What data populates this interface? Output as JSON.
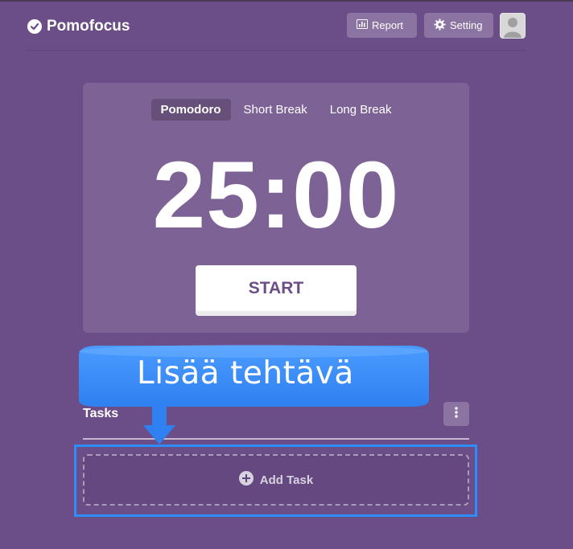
{
  "app": {
    "brand": "Pomofocus"
  },
  "header": {
    "report_label": "Report",
    "setting_label": "Setting"
  },
  "timer": {
    "modes": [
      "Pomodoro",
      "Short Break",
      "Long Break"
    ],
    "active_mode_index": 0,
    "time": "25:00",
    "start_label": "START"
  },
  "overlay": {
    "callout_text": "Lisää tehtävä"
  },
  "tasks": {
    "title": "Tasks",
    "add_task_label": "Add Task"
  },
  "colors": {
    "background": "#6b4d87",
    "callout": "#2f8cff",
    "highlight_border": "#2f8cff"
  },
  "icons": {
    "brand": "check-circle-icon",
    "report": "bar-chart-icon",
    "setting": "gear-icon",
    "tasks_menu": "kebab-menu-icon",
    "add_task": "plus-circle-icon",
    "avatar": "user-icon"
  }
}
